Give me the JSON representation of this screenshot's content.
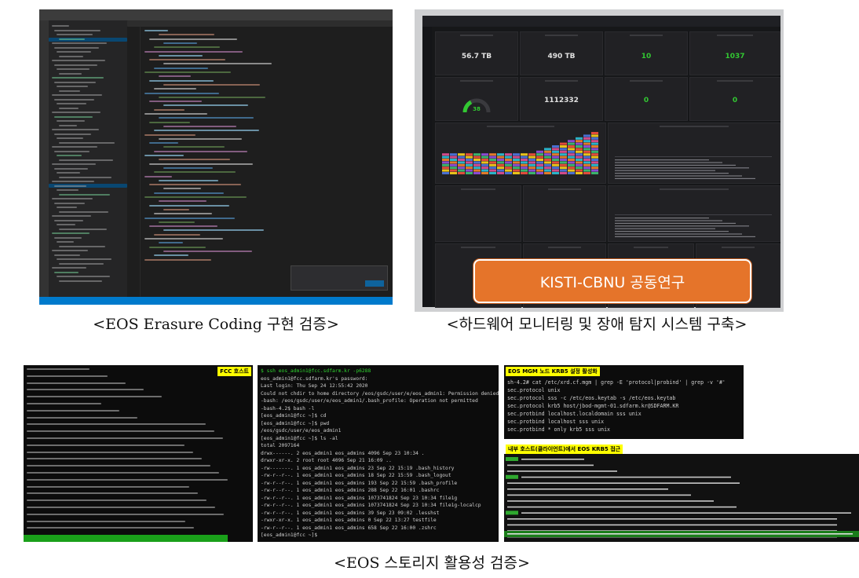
{
  "captions": {
    "top_left": "<EOS Erasure Coding 구현 검증>",
    "top_right": "<하드웨어 모니터링 및 장애 탐지 시스템 구축>",
    "bottom": "<EOS 스토리지 활용성 검증>"
  },
  "grafana": {
    "stats": [
      "56.7 TB",
      "490 TB",
      "10",
      "1037",
      "1112332",
      "0",
      "0"
    ],
    "gauge_value": "38",
    "overlay_label": "KISTI-CBNU 공동연구"
  },
  "terminals": {
    "fcc_header": "FCC 호스트",
    "mgm_header": "EOS MGM 노드 KRB5 설정 활성화",
    "client_header": "내부 호스트(클라이언트)에서 EOS KRB5 접근",
    "middle_lines": [
      "$ ssh eos_admin1@fcc.sdfarm.kr -p6288",
      "eos_admin1@fcc.sdfarm.kr's password:",
      "Last login: Thu Sep 24 12:55:42 2020",
      "Could not chdir to home directory /eos/gsdc/user/e/eos_admin1: Permission denied",
      "-bash: /eos/gsdc/user/e/eos_admin1/.bash_profile: Operation not permitted",
      "-bash-4.2$ bash -l",
      "[eos_admin1@fcc ~]$ cd",
      "[eos_admin1@fcc ~]$ pwd",
      "/eos/gsdc/user/e/eos_admin1",
      "[eos_admin1@fcc ~]$ ls -al",
      "total 2097164",
      "drwx------. 2 eos_admin1 eos_admins      4096 Sep 23 10:34 .",
      "drwxr-xr-x. 2 root       root            4096 Sep 21 16:09 ..",
      "-rw-------. 1 eos_admin1 eos_admins        23 Sep 22 15:19 .bash_history",
      "-rw-r--r--. 1 eos_admin1 eos_admins        18 Sep 22 15:59 .bash_logout",
      "-rw-r--r--. 1 eos_admin1 eos_admins       193 Sep 22 15:59 .bash_profile",
      "-rw-r--r--. 1 eos_admin1 eos_admins       288 Sep 22 16:01 .bashrc",
      "-rw-r--r--. 1 eos_admin1 eos_admins 1073741824 Sep 23 10:34 file1g",
      "-rw-r--r--. 1 eos_admin1 eos_admins 1073741824 Sep 23 10:34 file1g-localcp",
      "-rw-r--r--. 1 eos_admin1 eos_admins        39 Sep 23 09:02 .lesshst",
      "-rwxr-xr-x. 1 eos_admin1 eos_admins         0 Sep 22 13:27 testfile",
      "-rw-r--r--. 1 eos_admin1 eos_admins       658 Sep 22 16:00 .zshrc",
      "[eos_admin1@fcc ~]$ "
    ],
    "mgm_lines": [
      "sh-4.2# cat /etc/xrd.cf.mgm | grep -E 'protocol|probind' | grep -v '#'",
      "sec.protocol unix",
      "sec.protocol sss -c /etc/eos.keytab -s /etc/eos.keytab",
      "sec.protocol krb5 host/jbod-mgmt-01.sdfarm.kr@SDFARM.KR",
      "sec.protbind localhost.localdomain sss unix",
      "sec.protbind localhost sss unix",
      "sec.protbind * only krb5 sss unix"
    ]
  }
}
